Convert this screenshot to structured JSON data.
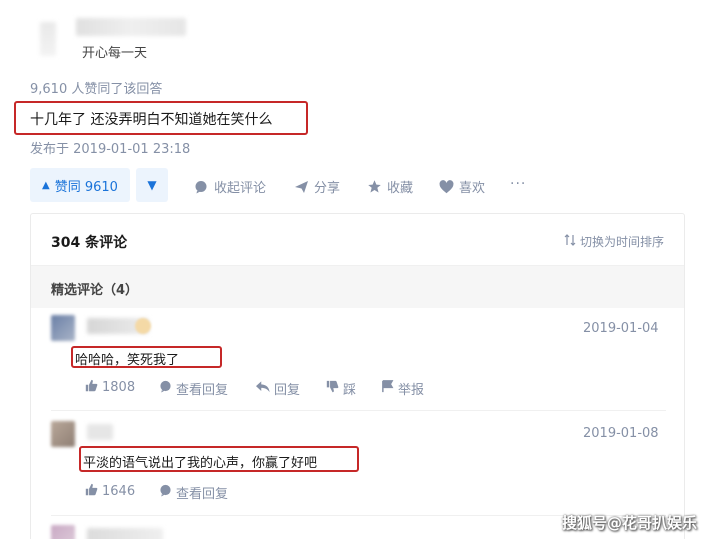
{
  "author": {
    "bio": "开心每一天"
  },
  "answer": {
    "vote_count_text": "9,610 人赞同了该回答",
    "text": "十几年了 还没弄明白不知道她在笑什么",
    "published": "发布于 2019-01-01 23:18"
  },
  "actions": {
    "upvote": "赞同 9610",
    "collapse_comments": "收起评论",
    "share": "分享",
    "favorite": "收藏",
    "like": "喜欢",
    "more": "···"
  },
  "comments": {
    "count_label": "304 条评论",
    "sort_label": "切换为时间排序",
    "featured_label": "精选评论（4）",
    "items": [
      {
        "date": "2019-01-04",
        "text": "哈哈哈，笑死我了",
        "likes": "1808",
        "view_replies": "查看回复",
        "reply": "回复",
        "dislike": "踩",
        "report": "举报"
      },
      {
        "date": "2019-01-08",
        "text": "平淡的语气说出了我的心声，你赢了好吧",
        "likes": "1646",
        "view_replies": "查看回复"
      }
    ]
  },
  "watermark": "搜狐号@花哥扒娱乐",
  "colors": {
    "accent_blue": "#1a73d9",
    "highlight_red": "#c62828",
    "muted": "#8590a6"
  }
}
